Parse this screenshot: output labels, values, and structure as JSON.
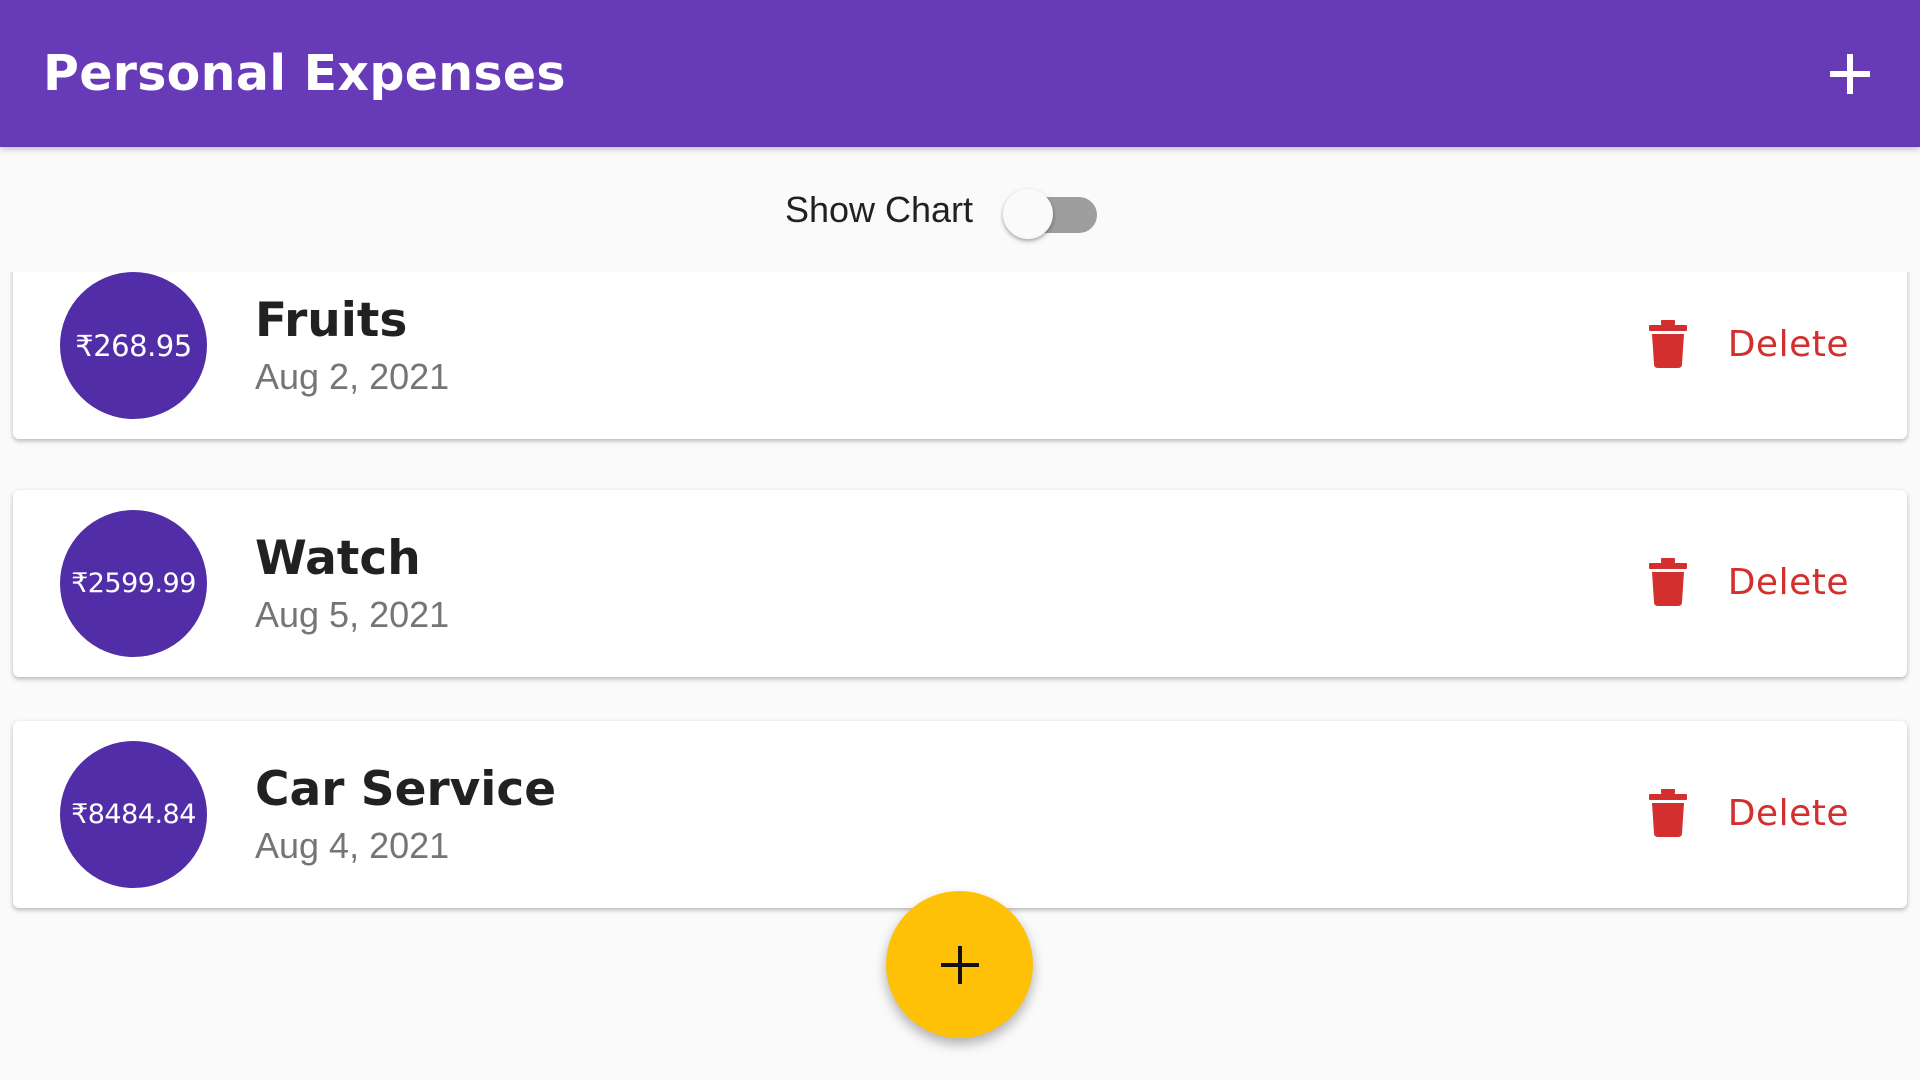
{
  "appbar": {
    "title": "Personal Expenses",
    "add_icon": "plus-icon",
    "background_color": "#673ab7"
  },
  "chart_toggle": {
    "label": "Show Chart",
    "on": false
  },
  "transactions": [
    {
      "amount": "₹268.95",
      "title": "Fruits",
      "date": "Aug 2, 2021",
      "delete_label": "Delete"
    },
    {
      "amount": "₹2599.99",
      "title": "Watch",
      "date": "Aug 5, 2021",
      "delete_label": "Delete"
    },
    {
      "amount": "₹8484.84",
      "title": "Car Service",
      "date": "Aug 4, 2021",
      "delete_label": "Delete"
    }
  ],
  "colors": {
    "primary": "#673ab7",
    "avatar": "#512da8",
    "delete": "#d32f2f",
    "fab": "#ffc107"
  },
  "fab": {
    "icon": "plus-icon"
  }
}
